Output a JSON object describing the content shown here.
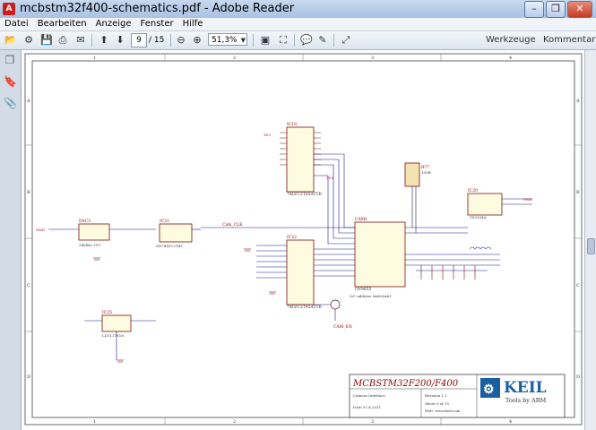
{
  "window": {
    "title": "mcbstm32f400-schematics.pdf - Adobe Reader",
    "app_icon_glyph": "A"
  },
  "menu": [
    "Datei",
    "Bearbeiten",
    "Anzeige",
    "Fenster",
    "Hilfe"
  ],
  "toolbar": {
    "page_current": "9",
    "page_separator": "/ 15",
    "zoom": "51,3%",
    "tools_label": "Werkzeuge",
    "comment_label": "Kommentar"
  },
  "icons": [
    "open-icon",
    "settings-icon",
    "save-icon",
    "print-icon",
    "email-icon",
    "prev-page-icon",
    "next-page-icon",
    "zoom-out-icon",
    "zoom-in-icon",
    "fit-page-icon",
    "full-screen-icon",
    "comment-icon",
    "highlight-icon",
    "read-mode-icon",
    "pages-panel-icon",
    "bookmarks-panel-icon",
    "attachments-panel-icon"
  ],
  "schematic": {
    "col_labels": [
      "1",
      "2",
      "3",
      "4"
    ],
    "row_labels": [
      "A",
      "B",
      "C",
      "D"
    ],
    "components": {
      "u18": {
        "ref": "IC18",
        "part": "74LVC2T45ATTR"
      },
      "u23": {
        "ref": "DSC3",
        "part": "24MHz 3V3"
      },
      "u21": {
        "ref": "IC21",
        "part": "SN74LVC2T45"
      },
      "u22": {
        "ref": "IC22",
        "part": "74LVC2T45ATTR"
      },
      "cam": {
        "ref": "CAM1",
        "part": "OV9655",
        "note": "I2C address 0x60/0x61"
      },
      "u25": {
        "ref": "IC25",
        "part": "LD1117S18"
      },
      "u20": {
        "ref": "IC20",
        "part": "TS3104A"
      },
      "r77": {
        "ref": "R77",
        "value": "100R"
      }
    },
    "net_labels": {
      "cam_clk": "Cam_CLK",
      "cam_en": "CAM_EN",
      "gnd": "GND",
      "v33": "3V3"
    },
    "title_block": {
      "title": "MCBSTM32F200/F400",
      "logo_text": "KEIL",
      "logo_sub": "Tools by ARM",
      "sheet_title": "Camera Interface",
      "revision": "Revision 1.1",
      "sheet": "Sheet 9 of 15",
      "date": "Date 07.4.2011",
      "web": "Web: www.keil.com"
    }
  },
  "colors": {
    "wire": "#1b1b8a",
    "label": "#8b0000",
    "title": "#8b0000",
    "logo": "#1a5fa0"
  }
}
